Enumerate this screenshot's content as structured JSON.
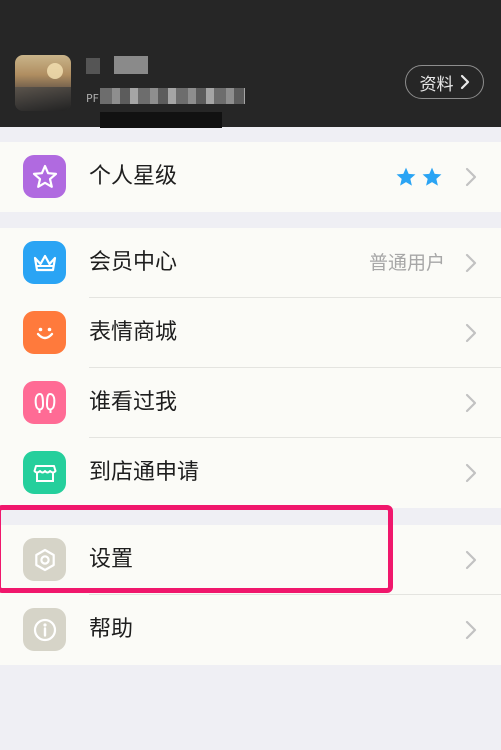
{
  "profile": {
    "button_label": "资料",
    "name_fragment": "PF"
  },
  "menu": {
    "section1": [
      {
        "label": "个人星级",
        "stars": 2,
        "icon": "star-icon",
        "color": "#b06ae0"
      }
    ],
    "section2": [
      {
        "label": "会员中心",
        "value": "普通用户",
        "icon": "crown-icon",
        "color": "#2aa4f4"
      },
      {
        "label": "表情商城",
        "icon": "smiley-icon",
        "color": "#ff7a3c"
      },
      {
        "label": "谁看过我",
        "icon": "footprints-icon",
        "color": "#ff6b95"
      },
      {
        "label": "到店通申请",
        "icon": "store-icon",
        "color": "#25cf9c"
      }
    ],
    "section3": [
      {
        "label": "设置",
        "icon": "gear-icon",
        "color": "#d6d4c8"
      },
      {
        "label": "帮助",
        "icon": "info-icon",
        "color": "#d6d4c8"
      }
    ]
  },
  "colors": {
    "header_bg": "#262626",
    "page_bg": "#efeff4",
    "highlight": "#f0176c",
    "star": "#2aa4f4"
  }
}
